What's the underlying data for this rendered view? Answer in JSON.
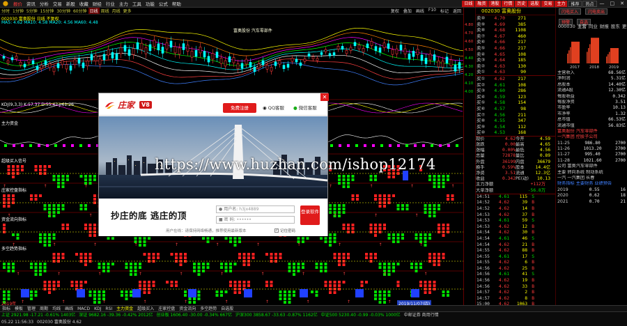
{
  "menubar": {
    "logo": "⬤",
    "items": [
      "报价",
      "资讯",
      "分析",
      "交易",
      "新股",
      "收藏",
      "财经",
      "行业",
      "主力",
      "工具",
      "功能",
      "公式",
      "帮助"
    ],
    "active_index": 0,
    "right_buttons": [
      "日线",
      "融资",
      "港股",
      "行情",
      "历史",
      "选股",
      "交易",
      "主力",
      "推荐",
      "热点"
    ],
    "window_controls": [
      "—",
      "□",
      "✕"
    ]
  },
  "periods": {
    "items": [
      "分时",
      "1分钟",
      "5分钟",
      "15分钟",
      "30分钟",
      "60分钟",
      "日线",
      "周线",
      "月线",
      "更多"
    ],
    "selected_index": 6,
    "tools": [
      "复权",
      "叠加",
      "画线",
      "F10",
      "标记",
      "返回"
    ]
  },
  "chart": {
    "header_line1": "002030 富奥股份 日线 不复权",
    "header_line2": "MA5: 4.62  MA10: 4.58  MA20: 4.56  MA60: 4.48",
    "title": "富奥股份 汽车零部件",
    "indicator_labels": [
      "KDJ(9,3,3) K:57.37 D:55.42 J:61.26",
      "主力资金",
      "超级买入信号",
      "庄家控盘指标",
      "资金流向指标",
      "多空趋势指标"
    ],
    "date_left": "2019年",
    "date_right": "2019/11/07(四)",
    "price_axis": [
      "4.80",
      "4.70",
      "4.60",
      "4.50",
      "4.40",
      "4.30",
      "4.20",
      "4.10",
      "4.00"
    ]
  },
  "quote": {
    "title": "002030 富奥股份",
    "sell": [
      {
        "lv": "卖⑩",
        "price": "4.70",
        "vol": "271"
      },
      {
        "lv": "卖⑨",
        "price": "4.69",
        "vol": "385"
      },
      {
        "lv": "卖⑧",
        "price": "4.68",
        "vol": "1108"
      },
      {
        "lv": "卖⑦",
        "price": "4.67",
        "vol": "460"
      },
      {
        "lv": "卖⑥",
        "price": "4.66",
        "vol": "217"
      },
      {
        "lv": "卖⑤",
        "price": "4.66",
        "vol": "217"
      },
      {
        "lv": "卖④",
        "price": "4.65",
        "vol": "108"
      },
      {
        "lv": "卖③",
        "price": "4.64",
        "vol": "185"
      },
      {
        "lv": "卖②",
        "price": "4.63",
        "vol": "130"
      },
      {
        "lv": "卖①",
        "price": "4.63",
        "vol": "90"
      }
    ],
    "buy": [
      {
        "lv": "买①",
        "price": "4.62",
        "vol": "217"
      },
      {
        "lv": "买②",
        "price": "4.61",
        "vol": "108"
      },
      {
        "lv": "买③",
        "price": "4.60",
        "vol": "286"
      },
      {
        "lv": "买④",
        "price": "4.59",
        "vol": "123"
      },
      {
        "lv": "买⑤",
        "price": "4.58",
        "vol": "154"
      },
      {
        "lv": "买⑥",
        "price": "4.57",
        "vol": "98"
      },
      {
        "lv": "买⑦",
        "price": "4.56",
        "vol": "211"
      },
      {
        "lv": "买⑧",
        "price": "4.55",
        "vol": "347"
      },
      {
        "lv": "买⑨",
        "price": "4.54",
        "vol": "112"
      },
      {
        "lv": "买⑩",
        "price": "4.53",
        "vol": "168"
      }
    ],
    "stats": [
      {
        "k1": "现价",
        "v1": "4.62",
        "k2": "今开",
        "v2": "4.59"
      },
      {
        "k1": "涨跌",
        "v1": "0.00",
        "k2": "最高",
        "v2": "4.65"
      },
      {
        "k1": "涨幅",
        "v1": "0.00%",
        "k2": "最低",
        "v2": "4.56"
      },
      {
        "k1": "总量",
        "v1": "72878",
        "k2": "量比",
        "v2": "0.89"
      },
      {
        "k1": "外盘",
        "v1": "36199",
        "k2": "内盘",
        "v2": "36679"
      },
      {
        "k1": "换手",
        "v1": "0.59%",
        "k2": "股本",
        "v2": "14.4亿"
      },
      {
        "k1": "净资",
        "v1": "3.51",
        "k2": "流通",
        "v2": "12.3亿"
      },
      {
        "k1": "收益",
        "v1": "0.342",
        "k2": "PE(动)",
        "v2": "10.13"
      }
    ],
    "flow": [
      {
        "k": "主力净额",
        "v": "+112万"
      },
      {
        "k": "大单净额",
        "v": "-56.8万"
      }
    ],
    "ticks": [
      {
        "t": "14:51",
        "p": "4.61",
        "v": "115",
        "f": "S"
      },
      {
        "t": "14:52",
        "p": "4.62",
        "v": "39",
        "f": "B"
      },
      {
        "t": "14:52",
        "p": "4.62",
        "v": "14",
        "f": "B"
      },
      {
        "t": "14:53",
        "p": "4.62",
        "v": "37",
        "f": "B"
      },
      {
        "t": "14:53",
        "p": "4.61",
        "v": "59",
        "f": "S"
      },
      {
        "t": "14:53",
        "p": "4.62",
        "v": "12",
        "f": "B"
      },
      {
        "t": "14:54",
        "p": "4.62",
        "v": "30",
        "f": "B"
      },
      {
        "t": "14:54",
        "p": "4.61",
        "v": "46",
        "f": "S"
      },
      {
        "t": "14:54",
        "p": "4.62",
        "v": "21",
        "f": "B"
      },
      {
        "t": "14:55",
        "p": "4.62",
        "v": "88",
        "f": "B"
      },
      {
        "t": "14:55",
        "p": "4.61",
        "v": "17",
        "f": "S"
      },
      {
        "t": "14:55",
        "p": "4.62",
        "v": "6",
        "f": "B"
      },
      {
        "t": "14:56",
        "p": "4.62",
        "v": "25",
        "f": "B"
      },
      {
        "t": "14:56",
        "p": "4.61",
        "v": "41",
        "f": "S"
      },
      {
        "t": "14:56",
        "p": "4.62",
        "v": "19",
        "f": "B"
      },
      {
        "t": "14:56",
        "p": "4.62",
        "v": "33",
        "f": "B"
      },
      {
        "t": "14:57",
        "p": "4.62",
        "v": "2",
        "f": "B"
      },
      {
        "t": "14:57",
        "p": "4.62",
        "v": "8",
        "f": "B"
      },
      {
        "t": "15:00",
        "p": "4.62",
        "v": "1063",
        "f": "B"
      }
    ]
  },
  "right": {
    "buttons": [
      "闪电买入",
      "闪电卖出",
      "预警",
      "自选"
    ],
    "code": "000030",
    "tabs": [
      "主营",
      "同业",
      "财报",
      "股东",
      "更多"
    ],
    "selected_tab": 0,
    "bars": [
      {
        "year": "2017",
        "value": 0.78
      },
      {
        "year": "2018",
        "value": 0.92
      },
      {
        "year": "2019",
        "value": 0.55
      }
    ],
    "info": [
      {
        "k": "主营收入",
        "v": "68.56亿"
      },
      {
        "k": "净利润",
        "v": "5.31亿"
      },
      {
        "k": "总股本",
        "v": "14.40亿"
      },
      {
        "k": "流通A股",
        "v": "12.30亿"
      },
      {
        "k": "每股收益",
        "v": "0.342"
      },
      {
        "k": "每股净资",
        "v": "3.51"
      },
      {
        "k": "市盈率",
        "v": "10.13"
      },
      {
        "k": "市净率",
        "v": "1.32"
      },
      {
        "k": "总市值",
        "v": "66.53亿"
      },
      {
        "k": "流通市值",
        "v": "56.83亿"
      }
    ],
    "news": [
      "富奥股份 汽车零部件",
      "一汽集团 控股子公司"
    ],
    "table": [
      {
        "k": "11-25",
        "a": "986.80",
        "b": "2700"
      },
      {
        "k": "11-26",
        "a": "1013.20",
        "b": "2700"
      },
      {
        "k": "11-27",
        "a": "995.40",
        "b": "2700"
      },
      {
        "k": "11-28",
        "a": "1021.60",
        "b": "2700"
      }
    ],
    "notes": [
      "公司 富奥汽车零部件",
      "主要 转向系统 制动系统",
      "一汽 一汽集团 长春"
    ],
    "finance_label": "财务指标 主要财务 业绩预告",
    "finance": [
      {
        "k": "2019",
        "a": "0.55",
        "b": "16"
      },
      {
        "k": "2020",
        "a": "0.62",
        "b": "18"
      },
      {
        "k": "2021",
        "a": "0.70",
        "b": "21"
      }
    ]
  },
  "bottom_tabs": {
    "items": [
      "指标",
      "模板",
      "管理",
      "周期",
      "均线",
      "画线",
      "MACD",
      "KDJ",
      "RSI",
      "主力资金",
      "超级买入",
      "庄家控盘",
      "资金流向",
      "多空趋势",
      "自选股"
    ],
    "selected_index": 9
  },
  "status": {
    "line1": [
      {
        "t": "上证 2921.98  -17.21  -0.61%  1403亿",
        "c": "dn"
      },
      {
        "t": "深证 9682.16  -39.36  -0.42%  2012亿",
        "c": "dn"
      },
      {
        "t": "创业板 1606.40  -30.00  -0.34%  667亿",
        "c": "dn"
      },
      {
        "t": "沪深300 3858.67  -33.63  -0.87%  1162亿",
        "c": "dn"
      },
      {
        "t": "中证500 5230.40  -0.99  -0.03%  1000亿",
        "c": "dn"
      },
      {
        "t": "中邮证券 商用行情",
        "c": "txt"
      }
    ],
    "line2": [
      {
        "t": "05.22 11:56:33",
        "c": "txt"
      },
      {
        "t": "002030 富奥股份 4.62",
        "c": "txt"
      }
    ]
  },
  "dialog": {
    "brand": "庄家",
    "version": "V8",
    "register_label": "免费注册",
    "qq_label": "QQ客服",
    "wechat_label": "微信客服",
    "close": "✕",
    "slogan": "抄庄的底  逃庄的顶",
    "username_label": "用户名:",
    "username_value": "h3jx4889",
    "password_label": "密  码:",
    "password_value": "••••••",
    "login_label": "登录软件",
    "hint": "用户在线：请保持网络畅通，推荐使用最新版本",
    "remember_label": "记住密码",
    "remember_check": "✓"
  },
  "watermark": "https://www.huzhan.com/ishop12174",
  "colors": {
    "up": "#ff3b3b",
    "down": "#00e000",
    "accent": "#e01b1b"
  }
}
